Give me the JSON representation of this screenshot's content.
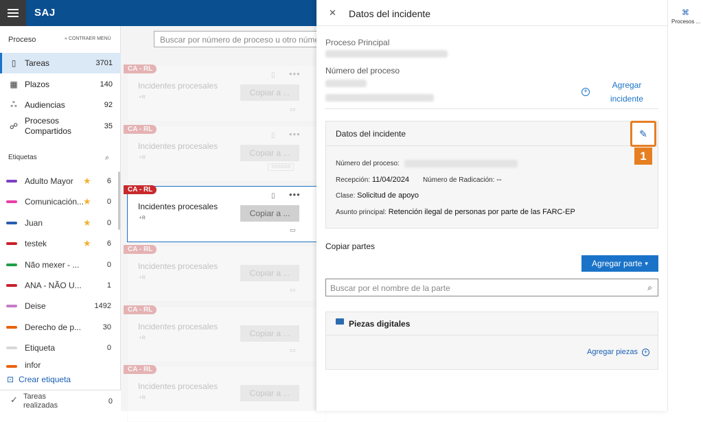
{
  "app": {
    "brand": "SAJ"
  },
  "sidebar": {
    "heading": "Proceso",
    "collapse_label": "CONTRAER MENÚ",
    "items": [
      {
        "label": "Tareas",
        "count": "3701",
        "icon": "clipboard-icon"
      },
      {
        "label": "Plazos",
        "count": "140",
        "icon": "calendar-icon"
      },
      {
        "label": "Audiencias",
        "count": "92",
        "icon": "people-icon"
      },
      {
        "label": "Procesos Compartidos",
        "count": "35",
        "icon": "shared-icon"
      }
    ],
    "tags_heading": "Etiquetas",
    "tags": [
      {
        "label": "Adulto Mayor",
        "count": "6",
        "color": "#7b3fc4",
        "starred": true
      },
      {
        "label": "Comunicación...",
        "count": "0",
        "color": "#e83ea5",
        "starred": true
      },
      {
        "label": "Juan",
        "count": "0",
        "color": "#2a5db0",
        "starred": true
      },
      {
        "label": "testek",
        "count": "6",
        "color": "#c8202a",
        "starred": true
      },
      {
        "label": "Não mexer - ...",
        "count": "0",
        "color": "#1e9e48",
        "starred": false
      },
      {
        "label": "ANA - NÃO U...",
        "count": "1",
        "color": "#c8202a",
        "starred": false
      },
      {
        "label": "Deise",
        "count": "1492",
        "color": "#c67bc6",
        "starred": false
      },
      {
        "label": "Derecho de p...",
        "count": "30",
        "color": "#e8620e",
        "starred": false
      },
      {
        "label": "Etiqueta",
        "count": "0",
        "color": "#d8d8d8",
        "starred": false
      },
      {
        "label": "infor",
        "count": "",
        "color": "#e8620e",
        "starred": false
      }
    ],
    "create_tag": "Crear etiqueta",
    "done_label": "Tareas realizadas",
    "done_count": "0"
  },
  "main": {
    "search_placeholder": "Buscar por número de proceso u otro número",
    "cards": [
      {
        "badge": "CA - RL",
        "title": "Incidentes procesales",
        "copy": "Copiar a ...",
        "chip": ""
      },
      {
        "badge": "CA - RL",
        "title": "Incidentes procesales",
        "copy": "Copiar a ...",
        "chip": "SSSSSS"
      },
      {
        "badge": "CA - RL",
        "title": "Incidentes procesales",
        "copy": "Copiar a ...",
        "chip": ""
      },
      {
        "badge": "CA - RL",
        "title": "Incidentes procesales",
        "copy": "Copiar a ...",
        "chip": ""
      },
      {
        "badge": "CA - RL",
        "title": "Incidentes procesales",
        "copy": "Copiar a ...",
        "chip": ""
      },
      {
        "badge": "CA - RL",
        "title": "Incidentes procesales",
        "copy": "Copiar a ...",
        "chip": ""
      }
    ]
  },
  "panel": {
    "title": "Datos del incidente",
    "proceso_principal_label": "Proceso Principal",
    "numero_proceso_label": "Número del proceso",
    "add_incident": "Agregar incidente",
    "incident_box": {
      "title": "Datos del incidente",
      "numero_label": "Número del proceso:",
      "recepcion_label": "Recepción:",
      "recepcion_value": "11/04/2024",
      "radicacion_label": "Número de Radicación:",
      "radicacion_value": "--",
      "clase_label": "Clase:",
      "clase_value": "Solicitud de apoyo",
      "asunto_label": "Asunto principal:",
      "asunto_value": "Retención ilegal de personas por parte de las FARC-EP"
    },
    "step_number": "1",
    "copiar_partes": "Copiar partes",
    "agregar_parte": "Agregar parte",
    "parte_search_placeholder": "Buscar por el nombre de la parte",
    "piezas_title": "Piezas digitales",
    "agregar_piezas": "Agregar piezas"
  },
  "right_rail": {
    "label": "Procesos ..."
  }
}
